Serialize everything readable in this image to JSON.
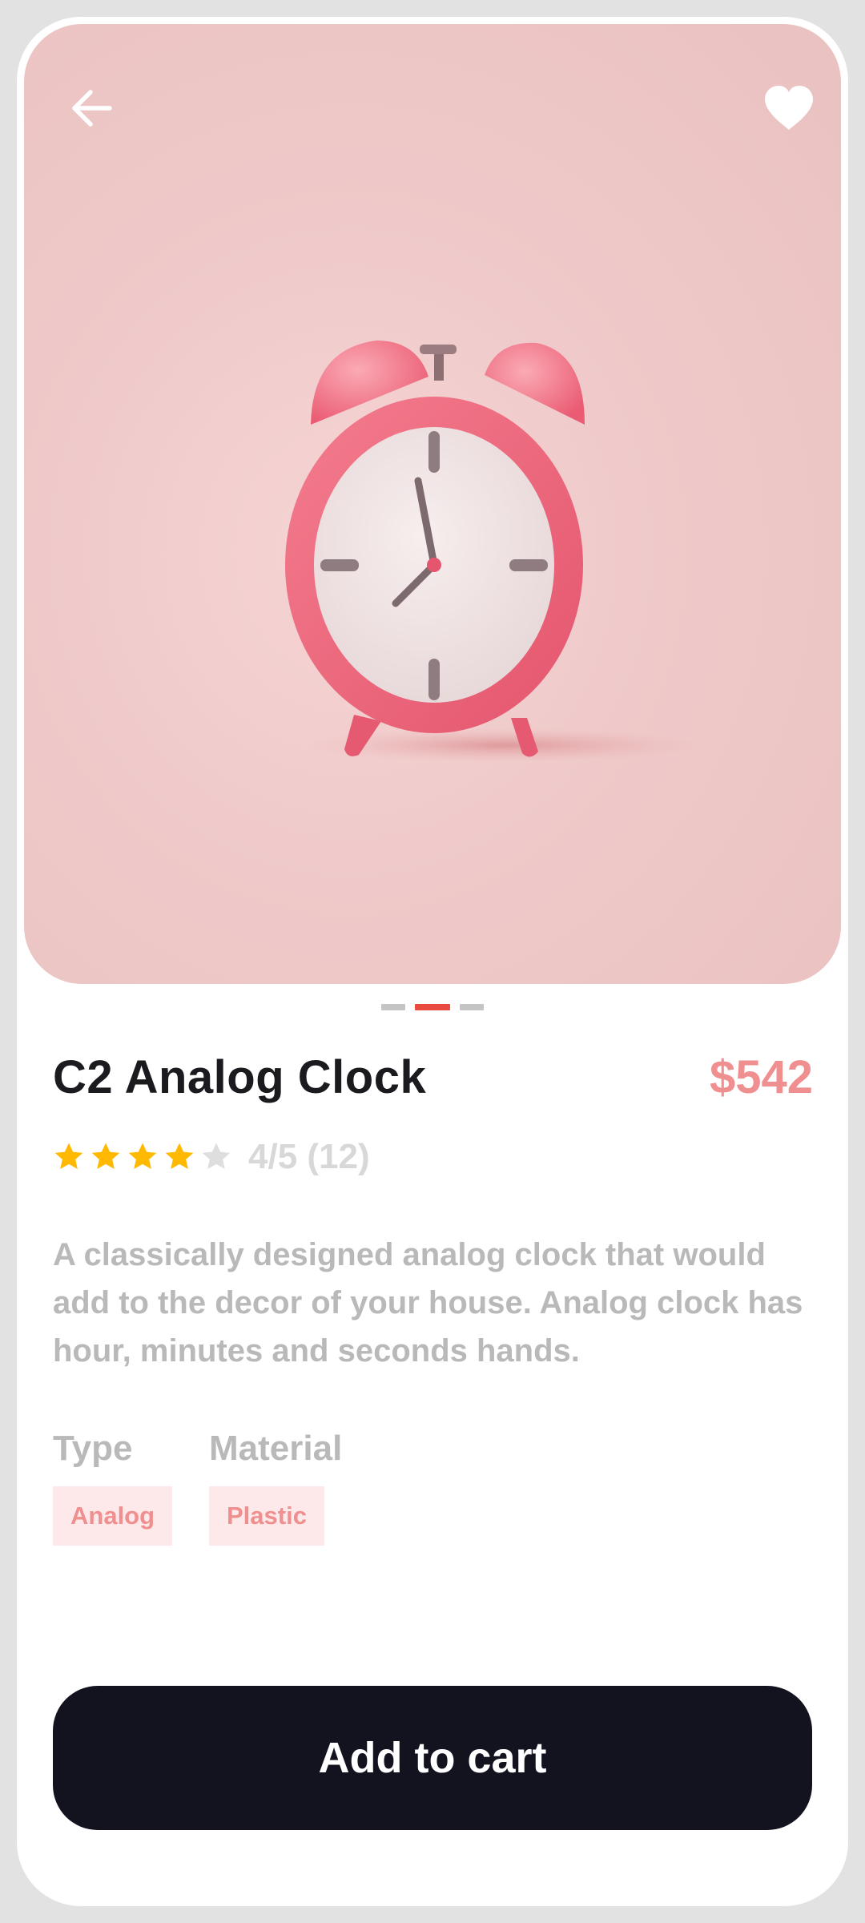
{
  "product": {
    "name": "C2 Analog Clock",
    "price": "$542",
    "rating_value": 4,
    "rating_max": 5,
    "rating_text": "4/5 (12)",
    "description": "A classically designed analog clock that would add to the decor of your house. Analog clock has hour, minutes and seconds hands."
  },
  "gallery": {
    "image_subject": "pink alarm clock",
    "page_count": 3,
    "active_index": 1
  },
  "attributes": [
    {
      "label": "Type",
      "value": "Analog"
    },
    {
      "label": "Material",
      "value": "Plastic"
    }
  ],
  "actions": {
    "add_to_cart_label": "Add to cart"
  },
  "icons": {
    "back": "arrow-left-icon",
    "favorite": "heart-icon",
    "star": "star-icon"
  },
  "colors": {
    "accent_price": "#ef8f8f",
    "star_filled": "#ffb900",
    "star_empty": "#dedede",
    "active_dot": "#e84a3e",
    "button_bg": "#12131f",
    "chip_bg": "#fde9e9"
  }
}
